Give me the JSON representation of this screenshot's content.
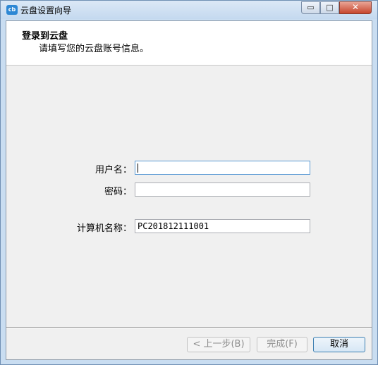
{
  "window": {
    "title": "云盘设置向导",
    "icon": "cloud-disk-app-icon",
    "app_icon_text": "cb",
    "buttons": {
      "minimize": "▭",
      "maximize": "□",
      "close": "✕"
    }
  },
  "header": {
    "title": "登录到云盘",
    "subtitle": "请填写您的云盘账号信息。"
  },
  "form": {
    "username_label": "用户名：",
    "username_value": "",
    "password_label": "密码：",
    "password_value": "",
    "computer_label": "计算机名称：",
    "computer_value": "PC201812111001"
  },
  "footer": {
    "back_label": "< 上一步(B)",
    "finish_label": "完成(F)",
    "cancel_label": "取消"
  }
}
